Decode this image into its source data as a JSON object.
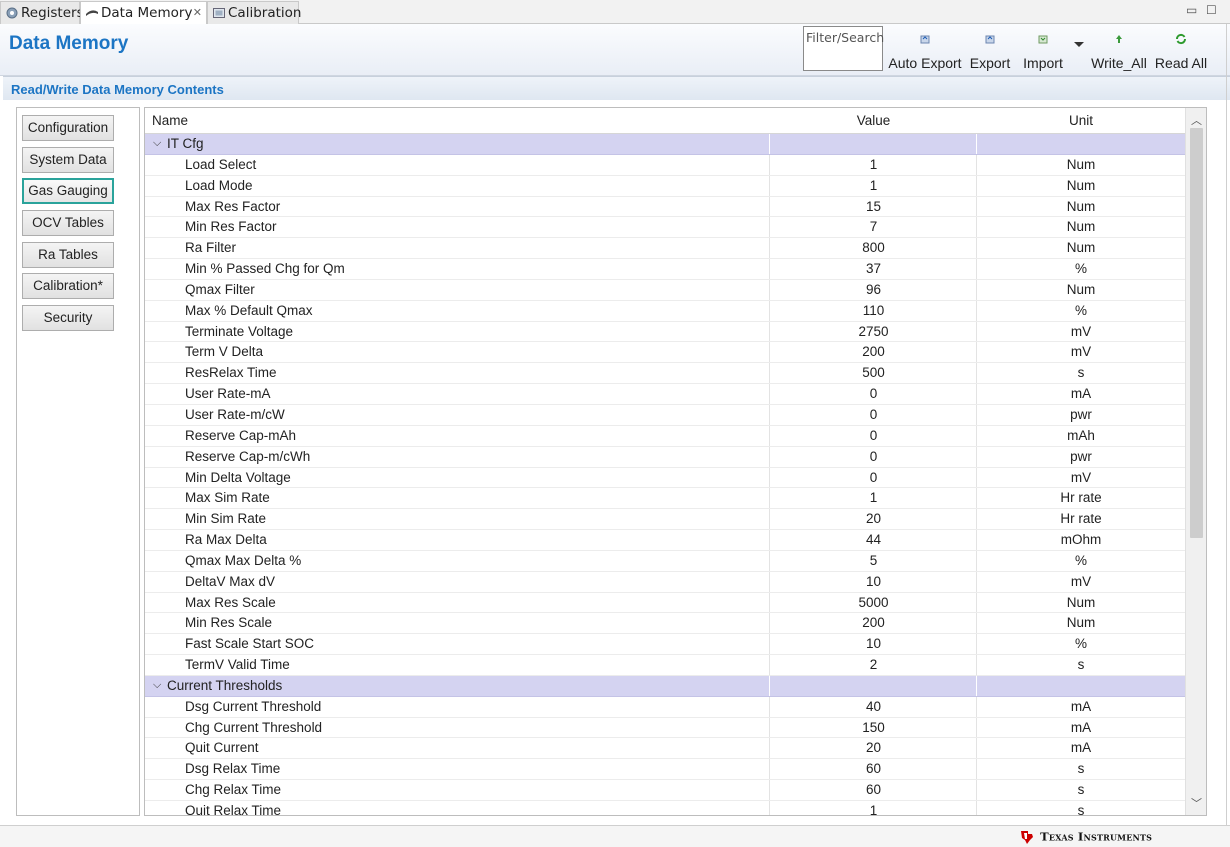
{
  "tabs": [
    {
      "label": "Registers",
      "icon": "gear-icon"
    },
    {
      "label": "Data Memory",
      "icon": "data-memory-icon",
      "close": "✕"
    },
    {
      "label": "Calibration",
      "icon": "calibration-icon"
    }
  ],
  "window_controls": {
    "minimize": "▭",
    "maximize": "☐"
  },
  "header": {
    "title": "Data Memory",
    "filter_placeholder": "Filter/Search",
    "toolbar": [
      {
        "label": "Auto Export",
        "icon": "auto-export-icon"
      },
      {
        "label": "Export",
        "icon": "export-icon"
      },
      {
        "label": "Import",
        "icon": "import-icon"
      },
      {
        "label": "Write_All",
        "icon": "write-all-icon"
      },
      {
        "label": "Read All",
        "icon": "read-all-icon"
      }
    ]
  },
  "section_title": "Read/Write Data Memory Contents",
  "nav": [
    {
      "label": "Configuration",
      "selected": false
    },
    {
      "label": "System Data",
      "selected": false
    },
    {
      "label": "Gas Gauging",
      "selected": true
    },
    {
      "label": "OCV Tables",
      "selected": false
    },
    {
      "label": "Ra Tables",
      "selected": false
    },
    {
      "label": "Calibration*",
      "selected": false
    },
    {
      "label": "Security",
      "selected": false
    }
  ],
  "table": {
    "columns": [
      "Name",
      "Value",
      "Unit"
    ],
    "groups": [
      {
        "name": "IT Cfg",
        "rows": [
          [
            "Load Select",
            "1",
            "Num"
          ],
          [
            "Load Mode",
            "1",
            "Num"
          ],
          [
            "Max Res Factor",
            "15",
            "Num"
          ],
          [
            "Min Res Factor",
            "7",
            "Num"
          ],
          [
            "Ra Filter",
            "800",
            "Num"
          ],
          [
            "Min % Passed Chg for Qm",
            "37",
            "%"
          ],
          [
            "Qmax Filter",
            "96",
            "Num"
          ],
          [
            "Max % Default Qmax",
            "110",
            "%"
          ],
          [
            "Terminate Voltage",
            "2750",
            "mV"
          ],
          [
            "Term V Delta",
            "200",
            "mV"
          ],
          [
            "ResRelax Time",
            "500",
            "s"
          ],
          [
            "User Rate-mA",
            "0",
            "mA"
          ],
          [
            "User Rate-m/cW",
            "0",
            "pwr"
          ],
          [
            "Reserve Cap-mAh",
            "0",
            "mAh"
          ],
          [
            "Reserve Cap-m/cWh",
            "0",
            "pwr"
          ],
          [
            "Min Delta Voltage",
            "0",
            "mV"
          ],
          [
            "Max Sim Rate",
            "1",
            "Hr rate"
          ],
          [
            "Min Sim Rate",
            "20",
            "Hr rate"
          ],
          [
            "Ra Max Delta",
            "44",
            "mOhm"
          ],
          [
            "Qmax Max Delta %",
            "5",
            "%"
          ],
          [
            "DeltaV Max dV",
            "10",
            "mV"
          ],
          [
            "Max Res Scale",
            "5000",
            "Num"
          ],
          [
            "Min Res Scale",
            "200",
            "Num"
          ],
          [
            "Fast Scale Start SOC",
            "10",
            "%"
          ],
          [
            "TermV Valid Time",
            "2",
            "s"
          ]
        ]
      },
      {
        "name": "Current Thresholds",
        "rows": [
          [
            "Dsg Current Threshold",
            "40",
            "mA"
          ],
          [
            "Chg Current Threshold",
            "150",
            "mA"
          ],
          [
            "Quit Current",
            "20",
            "mA"
          ],
          [
            "Dsg Relax Time",
            "60",
            "s"
          ],
          [
            "Chg Relax Time",
            "60",
            "s"
          ],
          [
            "Quit Relax Time",
            "1",
            "s"
          ]
        ]
      }
    ]
  },
  "footer": {
    "brand": "Texas Instruments"
  },
  "colors": {
    "accent": "#1c75c4",
    "group_row": "#d4d3f1",
    "selected_border": "#2aa39b",
    "ti_red": "#cc0000"
  }
}
